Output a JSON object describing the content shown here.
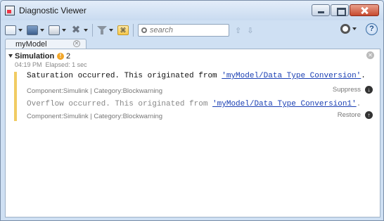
{
  "window": {
    "title": "Diagnostic Viewer"
  },
  "toolbar": {
    "search_placeholder": "search",
    "up_arrow": "⇧",
    "down_arrow": "⇩",
    "help": "?"
  },
  "tabs": [
    {
      "label": "myModel"
    }
  ],
  "run": {
    "title": "Simulation",
    "warning_count": "2",
    "time": "04:19 PM",
    "elapsed": "Elapsed: 1 sec"
  },
  "messages": [
    {
      "text_prefix": "Saturation occurred. This originated from ",
      "link": "'myModel/Data Type Conversion'",
      "text_suffix": ".",
      "meta": "Component:Simulink | Category:Blockwarning",
      "action": "Suppress"
    },
    {
      "text_prefix": "Overflow occurred. This originated from ",
      "link": "'myModel/Data Type Conversion1'",
      "text_suffix": ".",
      "meta": "Component:Simulink | Category:Blockwarning",
      "action": "Restore"
    }
  ],
  "colors": {
    "link": "#1a3fb3",
    "warning": "#f2a628",
    "stripe": "#f1cc63"
  }
}
